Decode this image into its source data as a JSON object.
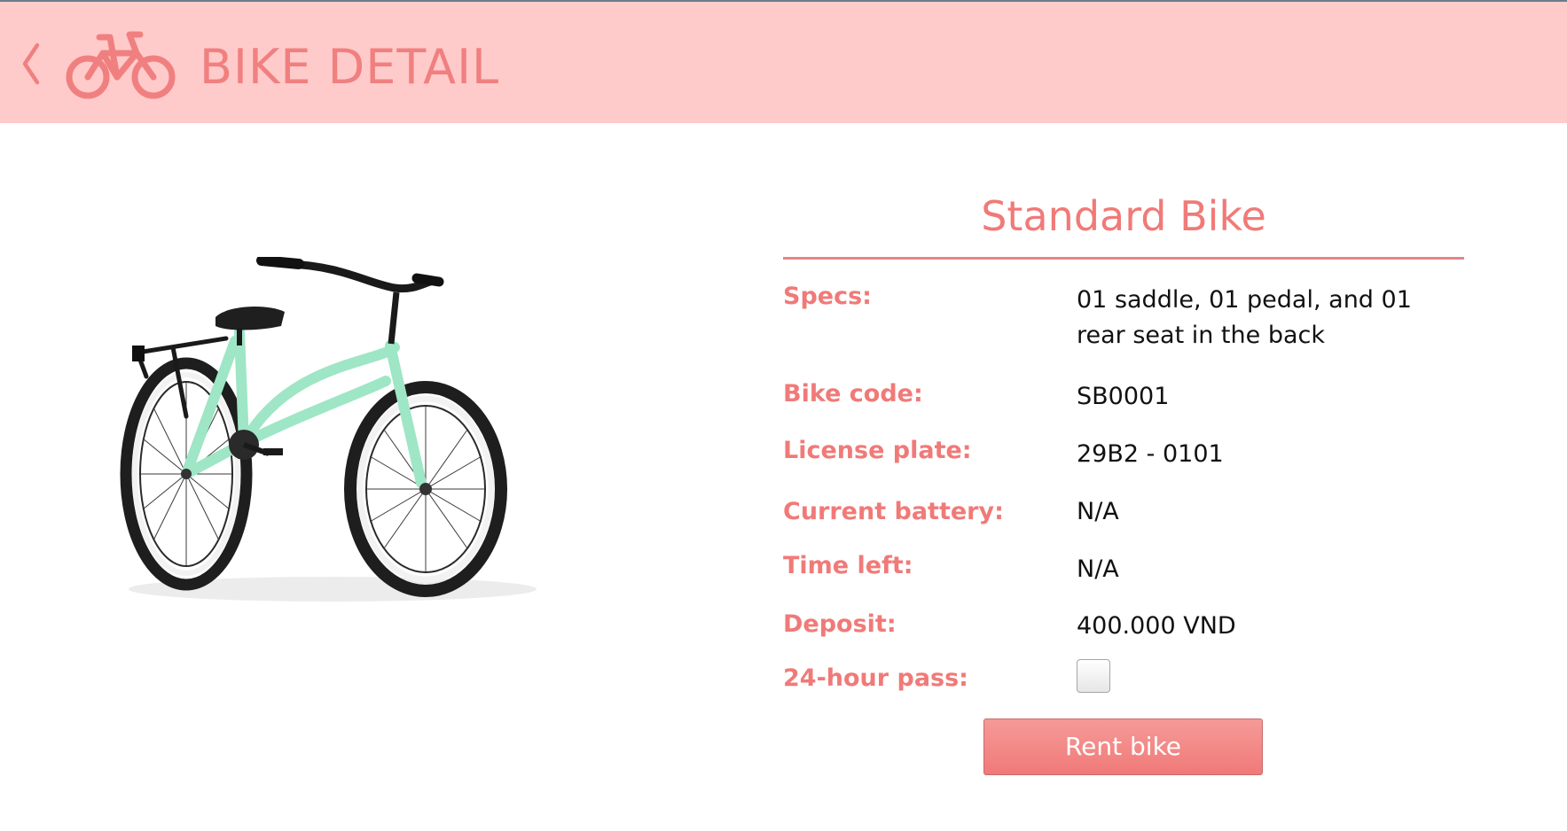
{
  "header": {
    "title": "BIKE DETAIL",
    "back_icon": "chevron-left-icon",
    "logo_icon": "bicycle-icon",
    "background_color": "#ffcaca",
    "accent_color": "#f08080"
  },
  "product": {
    "title": "Standard Bike",
    "image": "mint-green-cruiser-bike"
  },
  "details": [
    {
      "label": "Specs:",
      "value": "01 saddle, 01 pedal, and 01 rear seat in the back"
    },
    {
      "label": "Bike code:",
      "value": "SB0001"
    },
    {
      "label": "License plate:",
      "value": "29B2 - 0101"
    },
    {
      "label": "Current battery:",
      "value": "N/A"
    },
    {
      "label": "Time left:",
      "value": "N/A"
    },
    {
      "label": "Deposit:",
      "value": "400.000 VND"
    }
  ],
  "pass": {
    "label": "24-hour pass:",
    "checked": false
  },
  "actions": {
    "rent_label": "Rent bike",
    "rent_color": "#f07a78"
  }
}
